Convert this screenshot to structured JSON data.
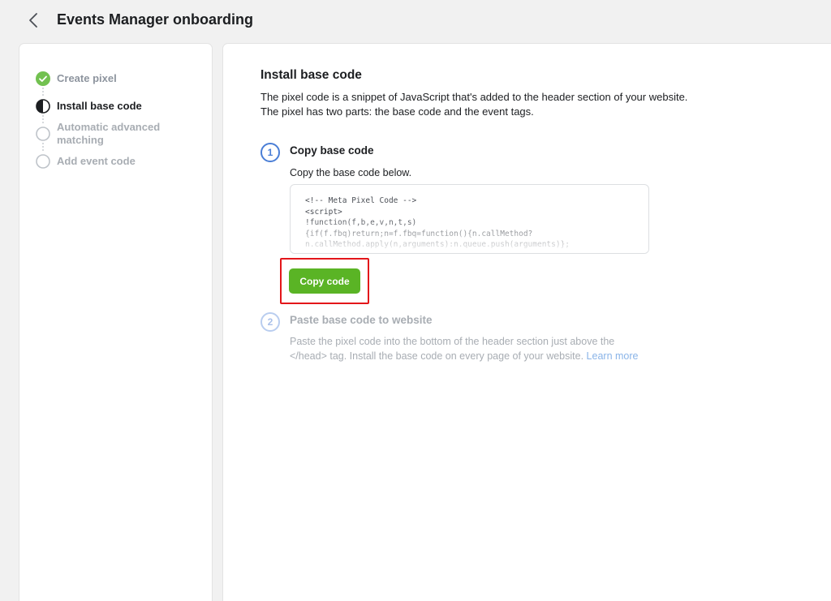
{
  "header": {
    "title": "Events Manager onboarding",
    "back_icon": "chevron-left-icon"
  },
  "sidebar": {
    "steps": [
      {
        "label": "Create pixel",
        "state": "done",
        "icon": "check-circle-icon"
      },
      {
        "label": "Install base code",
        "state": "active",
        "icon": "half-circle-icon"
      },
      {
        "label": "Automatic advanced matching",
        "state": "todo",
        "icon": "empty-circle-icon"
      },
      {
        "label": "Add event code",
        "state": "todo",
        "icon": "empty-circle-icon"
      }
    ]
  },
  "main": {
    "title": "Install base code",
    "intro_line1": "The pixel code is a snippet of JavaScript that's added to the header section of your website.",
    "intro_line2": "The pixel has two parts: the base code and the event tags.",
    "step1": {
      "number": "1",
      "title": "Copy base code",
      "description": "Copy the base code below.",
      "code_lines": [
        "<!-- Meta Pixel Code -->",
        "<script>",
        "!function(f,b,e,v,n,t,s)",
        "{if(f.fbq)return;n=f.fbq=function(){n.callMethod?",
        "n.callMethod.apply(n,arguments):n.queue.push(arguments)};"
      ],
      "copy_button": "Copy code"
    },
    "step2": {
      "number": "2",
      "title": "Paste base code to website",
      "description_line1": "Paste the pixel code into the bottom of the header section just above the",
      "description_line2": "</head> tag. Install the base code on every page of your website.",
      "learn_more": "Learn more"
    }
  },
  "colors": {
    "accent_blue": "#4a7ed6",
    "button_green": "#5ab425",
    "check_green": "#72c150",
    "highlight_red": "#e3161a"
  }
}
